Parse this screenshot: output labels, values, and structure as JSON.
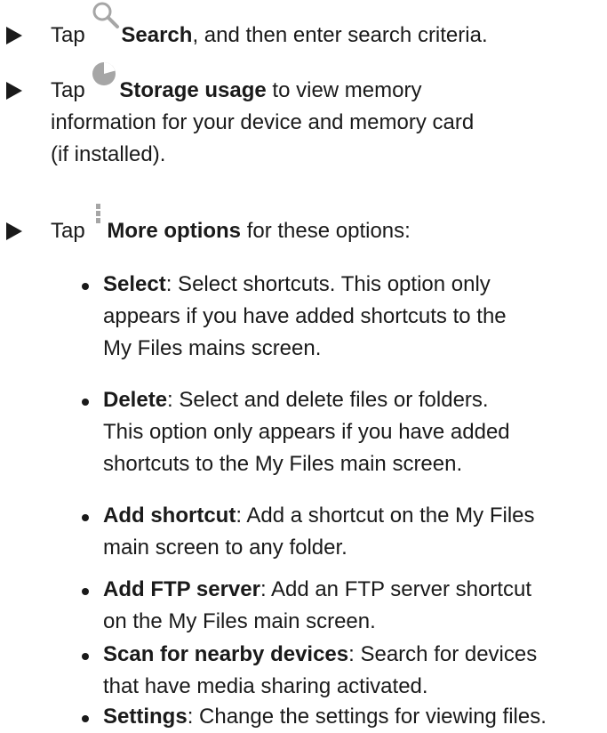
{
  "steps": [
    {
      "prefix": "Tap",
      "icon": "search-icon",
      "label": "Search",
      "suffix": ", and then enter search criteria."
    },
    {
      "prefix": "Tap",
      "icon": "storage-pie-icon",
      "label": "Storage usage",
      "suffix": " to view memory",
      "cont": [
        "information for your device and memory card",
        "(if installed)."
      ]
    },
    {
      "prefix": "Tap",
      "icon": "more-options-icon",
      "label": "More options",
      "suffix": " for these options:"
    }
  ],
  "options": [
    {
      "term": "Select",
      "lines": [
        ": Select shortcuts. This option only",
        "appears if you have added shortcuts to the",
        "My Files mains screen."
      ]
    },
    {
      "term": "Delete",
      "lines": [
        ": Select and delete files or folders.",
        "This option only appears if you have added",
        "shortcuts to the My Files main screen."
      ]
    },
    {
      "term": "Add shortcut",
      "lines": [
        ": Add a shortcut on the My Files",
        "main screen to any folder."
      ]
    },
    {
      "term": "Add FTP server",
      "lines": [
        ": Add an FTP server shortcut",
        "on the My Files main screen."
      ]
    },
    {
      "term": "Scan for nearby devices",
      "lines": [
        ": Search for devices",
        "that have media sharing activated."
      ]
    },
    {
      "term": "Settings",
      "lines": [
        ": Change the settings for viewing files."
      ]
    }
  ],
  "colors": {
    "text": "#1a1a1a",
    "icon": "#a6a6a6"
  }
}
